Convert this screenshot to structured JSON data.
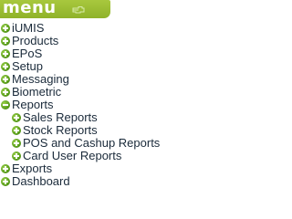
{
  "header": {
    "title": "menu",
    "icon": "pointing-hand-icon"
  },
  "colors": {
    "header_bg": "#9bbd34",
    "icon_green": "#5a9e1c",
    "text": "#1a2a3a"
  },
  "menu": {
    "items": [
      {
        "label": "iUMIS",
        "icon": "expand-plus-icon"
      },
      {
        "label": "Products",
        "icon": "expand-plus-icon"
      },
      {
        "label": "EPoS",
        "icon": "expand-plus-icon"
      },
      {
        "label": "Setup",
        "icon": "expand-plus-icon"
      },
      {
        "label": "Messaging",
        "icon": "expand-plus-icon"
      },
      {
        "label": "Biometric",
        "icon": "expand-plus-icon"
      },
      {
        "label": "Reports",
        "icon": "collapse-minus-icon",
        "children": [
          {
            "label": "Sales Reports",
            "icon": "expand-plus-icon"
          },
          {
            "label": "Stock Reports",
            "icon": "expand-plus-icon"
          },
          {
            "label": "POS and Cashup Reports",
            "icon": "expand-plus-icon"
          },
          {
            "label": "Card User Reports",
            "icon": "expand-plus-icon"
          }
        ]
      },
      {
        "label": "Exports",
        "icon": "expand-plus-icon"
      },
      {
        "label": "Dashboard",
        "icon": "expand-plus-icon"
      }
    ]
  }
}
